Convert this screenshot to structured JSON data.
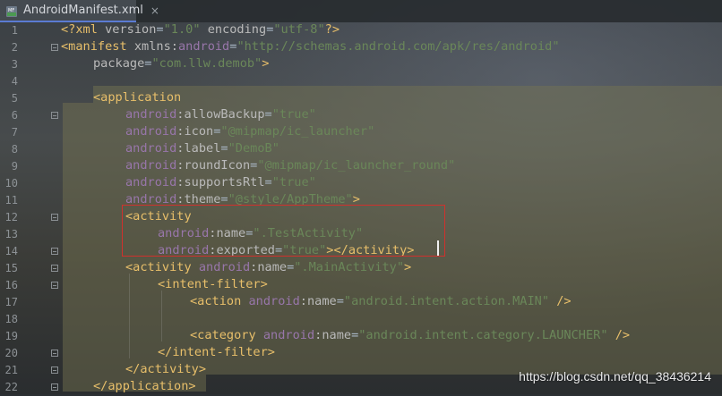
{
  "tab": {
    "title": "AndroidManifest.xml",
    "close_glyph": "×",
    "icon": "xml-file-icon"
  },
  "gutter": {
    "line_numbers": [
      "1",
      "2",
      "3",
      "4",
      "5",
      "6",
      "7",
      "8",
      "9",
      "10",
      "11",
      "12",
      "13",
      "14",
      "15",
      "16",
      "17",
      "18",
      "19",
      "20",
      "21",
      "22"
    ]
  },
  "code": {
    "l1": [
      "<?xml ",
      "version",
      "=",
      "\"1.0\"",
      " encoding",
      "=",
      "\"utf-8\"",
      "?>"
    ],
    "l2": [
      "<manifest ",
      "xmlns:",
      "android",
      "=",
      "\"http://schemas.android.com/apk/res/android\""
    ],
    "l3": [
      "package",
      "=",
      "\"com.llw.demob\"",
      ">"
    ],
    "l5": [
      "<application"
    ],
    "l6": [
      "android",
      ":allowBackup",
      "=",
      "\"true\""
    ],
    "l7": [
      "android",
      ":icon",
      "=",
      "\"@mipmap/ic_launcher\""
    ],
    "l8": [
      "android",
      ":label",
      "=",
      "\"DemoB\""
    ],
    "l9": [
      "android",
      ":roundIcon",
      "=",
      "\"@mipmap/ic_launcher_round\""
    ],
    "l10": [
      "android",
      ":supportsRtl",
      "=",
      "\"true\""
    ],
    "l11": [
      "android",
      ":theme",
      "=",
      "\"@style/AppTheme\"",
      ">"
    ],
    "l12": [
      "<activity"
    ],
    "l13": [
      "android",
      ":name",
      "=",
      "\".TestActivity\""
    ],
    "l14": [
      "android",
      ":exported",
      "=",
      "\"true\"",
      "></activity>"
    ],
    "l15": [
      "<activity ",
      "android",
      ":name",
      "=",
      "\".MainActivity\"",
      ">"
    ],
    "l16": [
      "<intent-filter>"
    ],
    "l17": [
      "<action ",
      "android",
      ":name",
      "=",
      "\"android.intent.action.MAIN\"",
      " />"
    ],
    "l19": [
      "<category ",
      "android",
      ":name",
      "=",
      "\"android.intent.category.LAUNCHER\"",
      " />"
    ],
    "l20": [
      "</intent-filter>"
    ],
    "l21": [
      "</activity>"
    ],
    "l22": [
      "</application>"
    ]
  },
  "watermark": "https://blog.csdn.net/qq_38436214",
  "colors": {
    "tag": "#e8bf6a",
    "namespace": "#9876aa",
    "attribute": "#bababa",
    "value": "#6a8759",
    "highlight_box": "#d0312d"
  }
}
